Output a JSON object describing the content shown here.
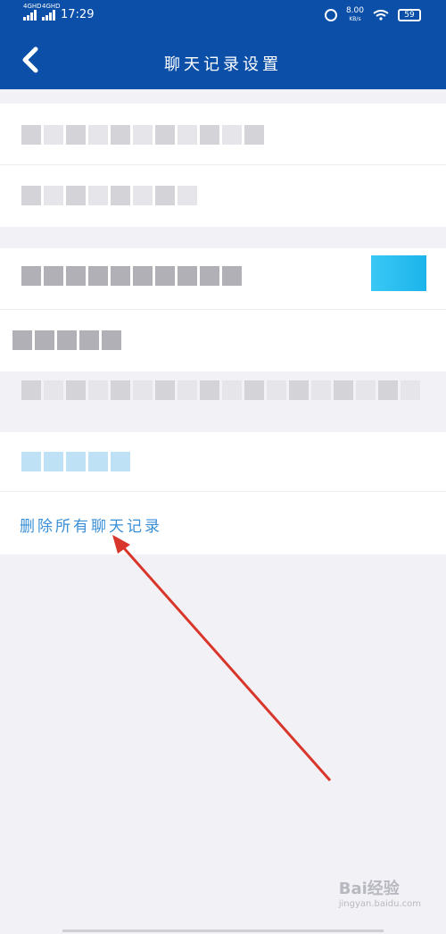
{
  "status_bar": {
    "network_1": "4G",
    "network_1_tag": "HD",
    "network_2": "4G",
    "network_2_tag": "HD",
    "time": "17:29",
    "speed_value": "8.00",
    "speed_unit": "KB/s",
    "battery": "59",
    "icons": [
      "alarm-icon",
      "wifi-icon",
      "battery-icon"
    ]
  },
  "header": {
    "back_icon": "chevron-left-icon",
    "title": "聊天记录设置"
  },
  "settings": {
    "delete_all_label": "删除所有聊天记录"
  },
  "watermark": {
    "logo": "Bai经验",
    "url": "jingyan.baidu.com"
  },
  "colors": {
    "header_bg": "#0b4fa8",
    "page_bg": "#f2f2f6",
    "link_blue": "#3b8fd6",
    "toggle_on": "#1bb4ea",
    "annotation_red": "#d9362b"
  }
}
